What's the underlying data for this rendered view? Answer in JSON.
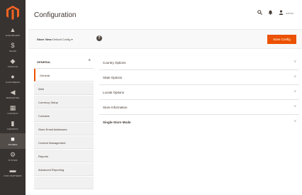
{
  "sidebar": {
    "items": [
      {
        "icon": "dashboard-icon",
        "glyph": "▲",
        "label": "DASHBOARD"
      },
      {
        "icon": "sales-icon",
        "glyph": "$",
        "label": "SALES"
      },
      {
        "icon": "catalog-icon",
        "glyph": "◆",
        "label": "CATALOG"
      },
      {
        "icon": "customers-icon",
        "glyph": "●",
        "label": "CUSTOMERS"
      },
      {
        "icon": "marketing-icon",
        "glyph": "◀",
        "label": "MARKETING"
      },
      {
        "icon": "content-icon",
        "glyph": "▦",
        "label": "CONTENT"
      },
      {
        "icon": "reports-icon",
        "glyph": "▮",
        "label": "REPORTS"
      },
      {
        "icon": "stores-icon",
        "glyph": "■",
        "label": "STORES"
      },
      {
        "icon": "system-icon",
        "glyph": "⚙",
        "label": "SYSTEM"
      },
      {
        "icon": "extensions-icon",
        "glyph": "▬",
        "label": "FIND PARTNERS"
      }
    ]
  },
  "header": {
    "title": "Configuration",
    "user_name": "admin"
  },
  "scope": {
    "label": "Store View:",
    "selected": "Default Config",
    "help": "?",
    "save_label": "Save Config"
  },
  "tabs": {
    "group_title": "GENERAL",
    "items": [
      {
        "label": "General",
        "active": true
      },
      {
        "label": "Web",
        "active": false
      },
      {
        "label": "Currency Setup",
        "active": false
      },
      {
        "label": "Contacts",
        "active": false
      },
      {
        "label": "Store Email Addresses",
        "active": false
      },
      {
        "label": "Content Management",
        "active": false
      },
      {
        "label": "Reports",
        "active": false
      },
      {
        "label": "Advanced Reporting",
        "active": false
      }
    ]
  },
  "sections": [
    {
      "title": "Country Options",
      "bold": false
    },
    {
      "title": "State Options",
      "bold": false
    },
    {
      "title": "Locale Options",
      "bold": false
    },
    {
      "title": "Store Information",
      "bold": false
    },
    {
      "title": "Single-Store Mode",
      "bold": true
    }
  ],
  "colors": {
    "accent": "#eb5202",
    "sidebar_bg": "#373330"
  }
}
